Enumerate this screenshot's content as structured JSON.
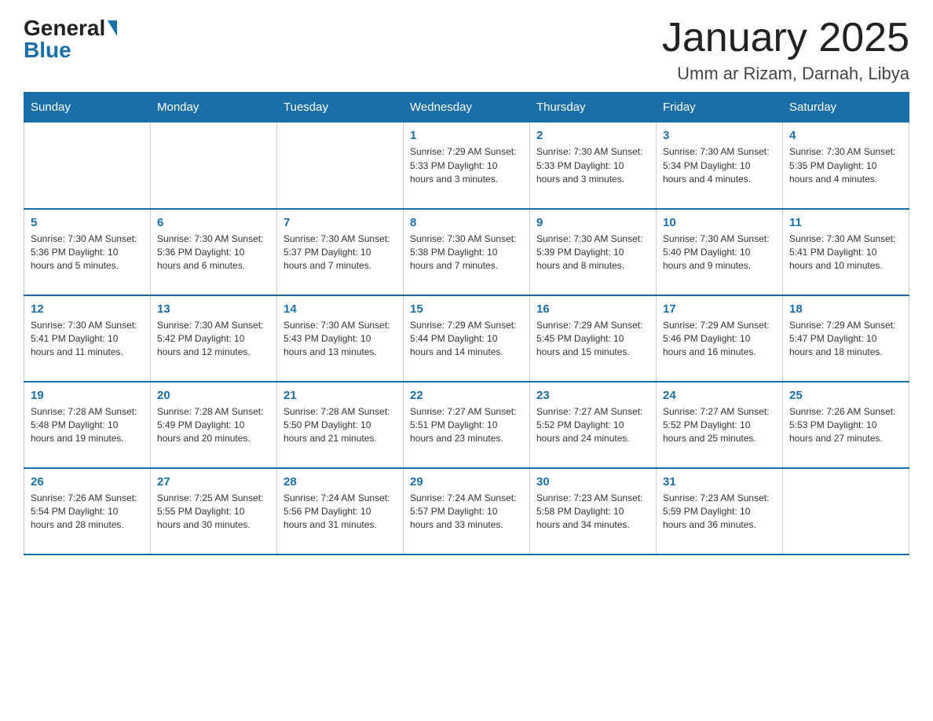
{
  "header": {
    "logo_text": "General",
    "logo_blue": "Blue",
    "month_title": "January 2025",
    "location": "Umm ar Rizam, Darnah, Libya"
  },
  "days_of_week": [
    "Sunday",
    "Monday",
    "Tuesday",
    "Wednesday",
    "Thursday",
    "Friday",
    "Saturday"
  ],
  "weeks": [
    [
      {
        "num": "",
        "info": ""
      },
      {
        "num": "",
        "info": ""
      },
      {
        "num": "",
        "info": ""
      },
      {
        "num": "1",
        "info": "Sunrise: 7:29 AM\nSunset: 5:33 PM\nDaylight: 10 hours and 3 minutes."
      },
      {
        "num": "2",
        "info": "Sunrise: 7:30 AM\nSunset: 5:33 PM\nDaylight: 10 hours and 3 minutes."
      },
      {
        "num": "3",
        "info": "Sunrise: 7:30 AM\nSunset: 5:34 PM\nDaylight: 10 hours and 4 minutes."
      },
      {
        "num": "4",
        "info": "Sunrise: 7:30 AM\nSunset: 5:35 PM\nDaylight: 10 hours and 4 minutes."
      }
    ],
    [
      {
        "num": "5",
        "info": "Sunrise: 7:30 AM\nSunset: 5:36 PM\nDaylight: 10 hours and 5 minutes."
      },
      {
        "num": "6",
        "info": "Sunrise: 7:30 AM\nSunset: 5:36 PM\nDaylight: 10 hours and 6 minutes."
      },
      {
        "num": "7",
        "info": "Sunrise: 7:30 AM\nSunset: 5:37 PM\nDaylight: 10 hours and 7 minutes."
      },
      {
        "num": "8",
        "info": "Sunrise: 7:30 AM\nSunset: 5:38 PM\nDaylight: 10 hours and 7 minutes."
      },
      {
        "num": "9",
        "info": "Sunrise: 7:30 AM\nSunset: 5:39 PM\nDaylight: 10 hours and 8 minutes."
      },
      {
        "num": "10",
        "info": "Sunrise: 7:30 AM\nSunset: 5:40 PM\nDaylight: 10 hours and 9 minutes."
      },
      {
        "num": "11",
        "info": "Sunrise: 7:30 AM\nSunset: 5:41 PM\nDaylight: 10 hours and 10 minutes."
      }
    ],
    [
      {
        "num": "12",
        "info": "Sunrise: 7:30 AM\nSunset: 5:41 PM\nDaylight: 10 hours and 11 minutes."
      },
      {
        "num": "13",
        "info": "Sunrise: 7:30 AM\nSunset: 5:42 PM\nDaylight: 10 hours and 12 minutes."
      },
      {
        "num": "14",
        "info": "Sunrise: 7:30 AM\nSunset: 5:43 PM\nDaylight: 10 hours and 13 minutes."
      },
      {
        "num": "15",
        "info": "Sunrise: 7:29 AM\nSunset: 5:44 PM\nDaylight: 10 hours and 14 minutes."
      },
      {
        "num": "16",
        "info": "Sunrise: 7:29 AM\nSunset: 5:45 PM\nDaylight: 10 hours and 15 minutes."
      },
      {
        "num": "17",
        "info": "Sunrise: 7:29 AM\nSunset: 5:46 PM\nDaylight: 10 hours and 16 minutes."
      },
      {
        "num": "18",
        "info": "Sunrise: 7:29 AM\nSunset: 5:47 PM\nDaylight: 10 hours and 18 minutes."
      }
    ],
    [
      {
        "num": "19",
        "info": "Sunrise: 7:28 AM\nSunset: 5:48 PM\nDaylight: 10 hours and 19 minutes."
      },
      {
        "num": "20",
        "info": "Sunrise: 7:28 AM\nSunset: 5:49 PM\nDaylight: 10 hours and 20 minutes."
      },
      {
        "num": "21",
        "info": "Sunrise: 7:28 AM\nSunset: 5:50 PM\nDaylight: 10 hours and 21 minutes."
      },
      {
        "num": "22",
        "info": "Sunrise: 7:27 AM\nSunset: 5:51 PM\nDaylight: 10 hours and 23 minutes."
      },
      {
        "num": "23",
        "info": "Sunrise: 7:27 AM\nSunset: 5:52 PM\nDaylight: 10 hours and 24 minutes."
      },
      {
        "num": "24",
        "info": "Sunrise: 7:27 AM\nSunset: 5:52 PM\nDaylight: 10 hours and 25 minutes."
      },
      {
        "num": "25",
        "info": "Sunrise: 7:26 AM\nSunset: 5:53 PM\nDaylight: 10 hours and 27 minutes."
      }
    ],
    [
      {
        "num": "26",
        "info": "Sunrise: 7:26 AM\nSunset: 5:54 PM\nDaylight: 10 hours and 28 minutes."
      },
      {
        "num": "27",
        "info": "Sunrise: 7:25 AM\nSunset: 5:55 PM\nDaylight: 10 hours and 30 minutes."
      },
      {
        "num": "28",
        "info": "Sunrise: 7:24 AM\nSunset: 5:56 PM\nDaylight: 10 hours and 31 minutes."
      },
      {
        "num": "29",
        "info": "Sunrise: 7:24 AM\nSunset: 5:57 PM\nDaylight: 10 hours and 33 minutes."
      },
      {
        "num": "30",
        "info": "Sunrise: 7:23 AM\nSunset: 5:58 PM\nDaylight: 10 hours and 34 minutes."
      },
      {
        "num": "31",
        "info": "Sunrise: 7:23 AM\nSunset: 5:59 PM\nDaylight: 10 hours and 36 minutes."
      },
      {
        "num": "",
        "info": ""
      }
    ]
  ]
}
